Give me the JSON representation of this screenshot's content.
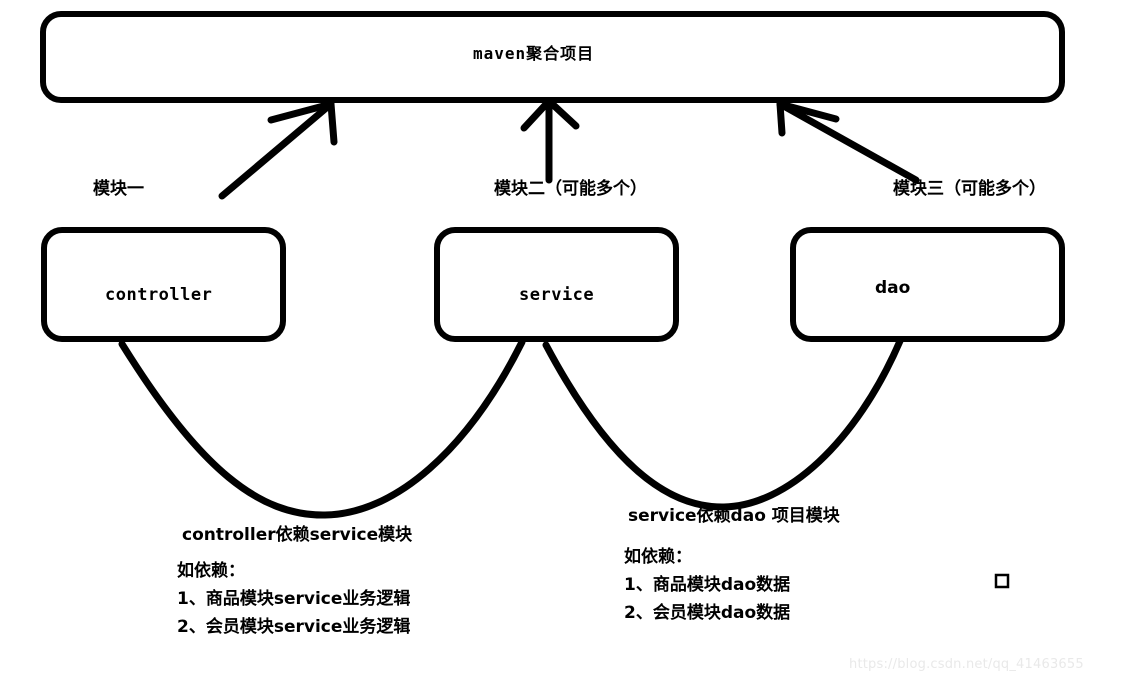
{
  "diagram": {
    "root_box": {
      "label": "maven聚合项目"
    },
    "connector_labels": [
      {
        "text": "模块一"
      },
      {
        "text": "模块二（可能多个）"
      },
      {
        "text": "模块三（可能多个）"
      }
    ],
    "module_boxes": [
      {
        "label": "controller"
      },
      {
        "label": "service"
      },
      {
        "label": "dao"
      }
    ],
    "notes": [
      {
        "title": "controller依赖service模块",
        "head": "如依赖：",
        "items": [
          "1、商品模块service业务逻辑",
          "2、会员模块service业务逻辑"
        ]
      },
      {
        "title": "service依赖dao 项目模块",
        "head": "如依赖：",
        "items": [
          "1、商品模块dao数据",
          "2、会员模块dao数据"
        ]
      }
    ],
    "marker": {
      "name": "small-square"
    },
    "stroke_color": "#000000",
    "background_color": "#ffffff"
  },
  "watermark": {
    "text": "https://blog.csdn.net/qq_41463655",
    "color": "#e9e9e9"
  }
}
